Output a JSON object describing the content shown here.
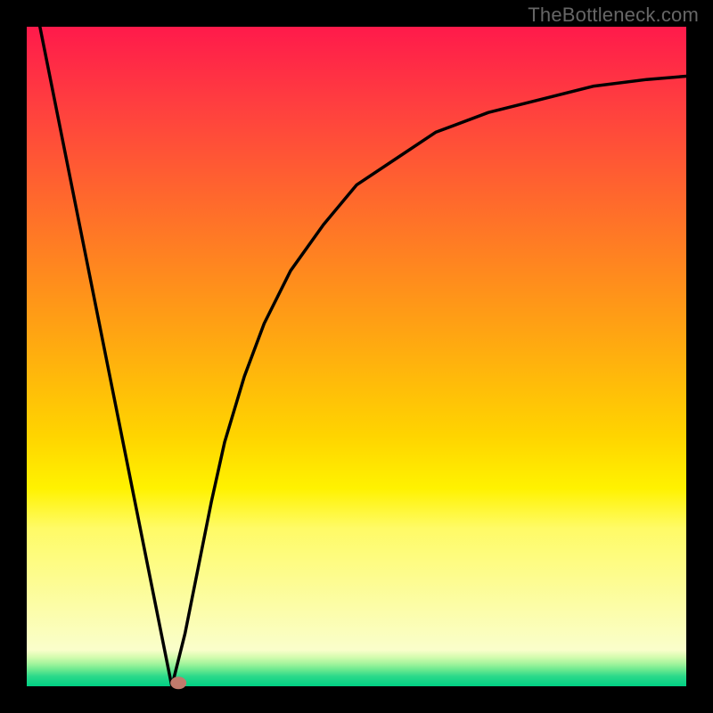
{
  "watermark": "TheBottleneck.com",
  "chart_data": {
    "type": "line",
    "title": "",
    "xlabel": "",
    "ylabel": "",
    "xlim": [
      0,
      100
    ],
    "ylim": [
      0,
      100
    ],
    "grid": false,
    "axes_visible": false,
    "series": [
      {
        "name": "left-line",
        "type": "line",
        "x": [
          2,
          22
        ],
        "y": [
          100,
          0
        ]
      },
      {
        "name": "right-curve",
        "type": "line",
        "x": [
          22,
          24,
          26,
          28,
          30,
          33,
          36,
          40,
          45,
          50,
          56,
          62,
          70,
          78,
          86,
          94,
          100
        ],
        "y": [
          0,
          8,
          18,
          28,
          37,
          47,
          55,
          63,
          70,
          76,
          80,
          84,
          87,
          89,
          91,
          92,
          92.5
        ]
      }
    ],
    "marker": {
      "name": "bottleneck-point",
      "x": 23,
      "y": 0.5,
      "color": "#c17a6c"
    },
    "gradient_stops": [
      {
        "offset": 0.0,
        "color": "#ff1a4b"
      },
      {
        "offset": 0.12,
        "color": "#ff3f3f"
      },
      {
        "offset": 0.28,
        "color": "#ff6e2a"
      },
      {
        "offset": 0.45,
        "color": "#ffa014"
      },
      {
        "offset": 0.62,
        "color": "#ffd400"
      },
      {
        "offset": 0.7,
        "color": "#fff200"
      },
      {
        "offset": 0.76,
        "color": "#fffb66"
      },
      {
        "offset": 0.945,
        "color": "#fafecb"
      },
      {
        "offset": 0.955,
        "color": "#d7fcb0"
      },
      {
        "offset": 0.965,
        "color": "#a7f59e"
      },
      {
        "offset": 0.975,
        "color": "#6be98f"
      },
      {
        "offset": 0.985,
        "color": "#2bd98a"
      },
      {
        "offset": 1.0,
        "color": "#00d084"
      }
    ],
    "frame": {
      "outer_size": 800,
      "inner_padding": 30,
      "border_color": "#000000",
      "curve_color": "#000000",
      "curve_width": 3.5
    }
  }
}
